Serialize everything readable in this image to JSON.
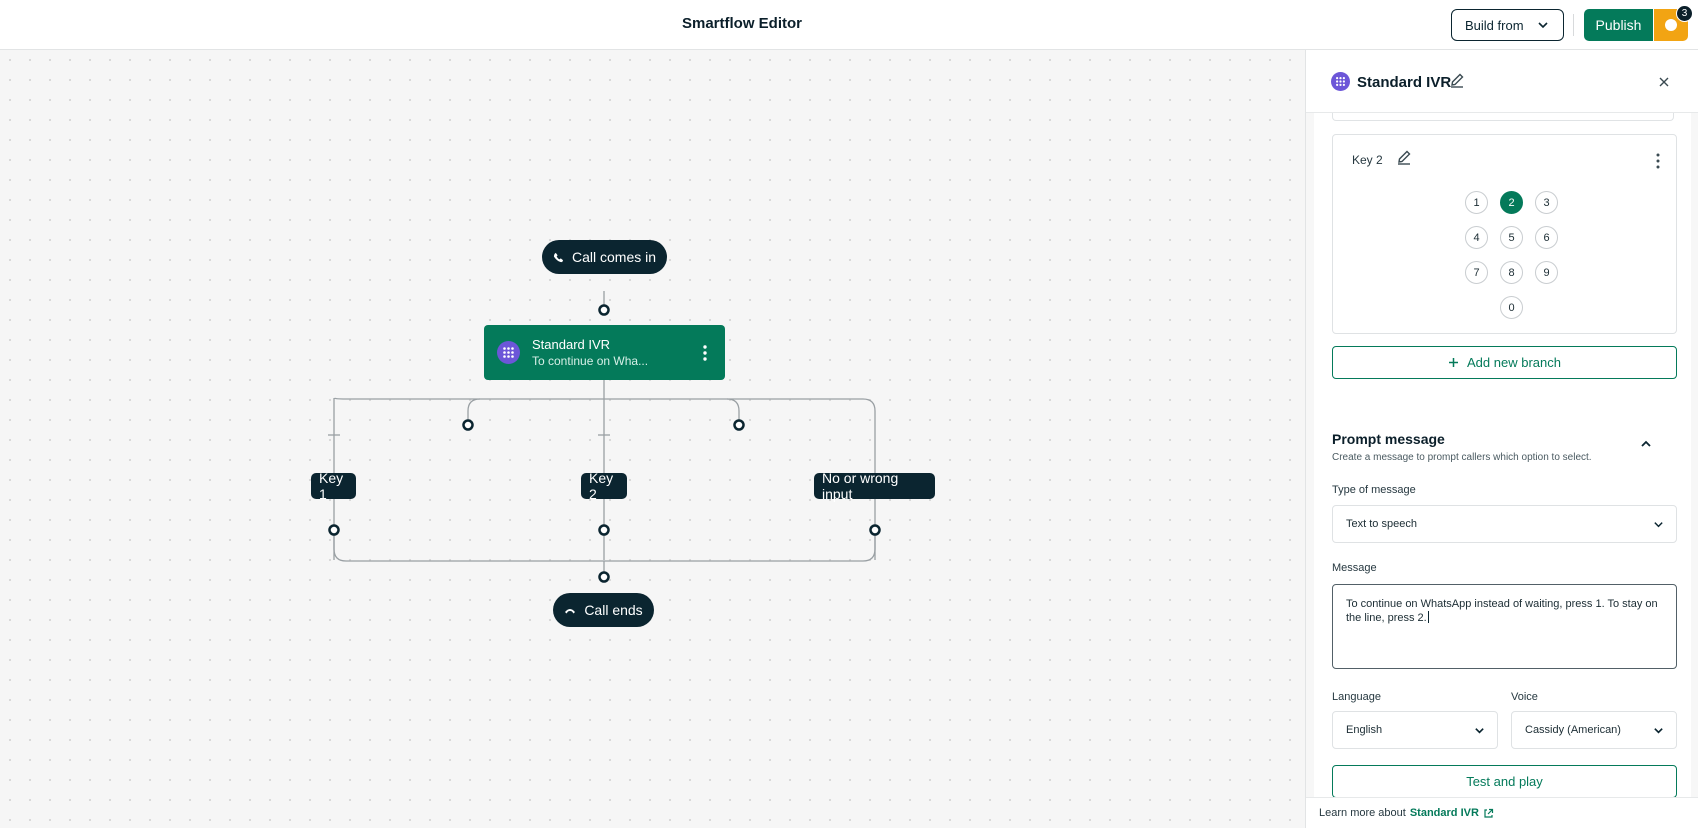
{
  "header": {
    "title": "Smartflow Editor",
    "build_from_label": "Build from",
    "publish_label": "Publish",
    "notification_count": "3"
  },
  "flow": {
    "start_label": "Call comes in",
    "ivr_title": "Standard IVR",
    "ivr_subtitle": "To continue on Wha...",
    "branches": [
      "Key 1",
      "Key 2",
      "No or wrong input"
    ],
    "end_label": "Call ends"
  },
  "panel": {
    "title": "Standard IVR",
    "key_label": "Key 2",
    "digits": [
      "1",
      "2",
      "3",
      "4",
      "5",
      "6",
      "7",
      "8",
      "9",
      "0"
    ],
    "selected_digit": "2",
    "add_branch_label": "Add new branch",
    "prompt": {
      "heading": "Prompt message",
      "description": "Create a message to prompt callers which option to select.",
      "type_label": "Type of message",
      "type_value": "Text to speech",
      "message_label": "Message",
      "message_value": "To continue on WhatsApp instead of waiting, press 1. To stay on the line, press 2.",
      "language_label": "Language",
      "language_value": "English",
      "voice_label": "Voice",
      "voice_value": "Cassidy (American)",
      "test_label": "Test and play"
    },
    "footer": {
      "text": "Learn more about",
      "link": "Standard IVR"
    }
  },
  "colors": {
    "brand_green": "#047a5a",
    "dark_navy": "#0b2530",
    "accent_orange": "#f2a413",
    "ivr_purple": "#6c56d8"
  }
}
